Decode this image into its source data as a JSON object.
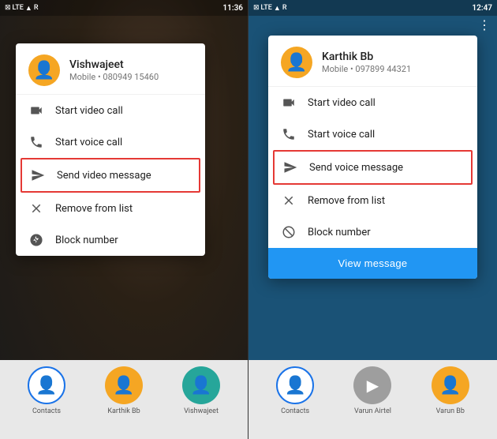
{
  "left_screen": {
    "status_bar": {
      "left_icons": "📶",
      "time": "11:36"
    },
    "contact": {
      "name": "Vishwajeet",
      "number": "Mobile • 080949 15460"
    },
    "menu_items": [
      {
        "id": "video-call",
        "label": "Start video call",
        "icon": "video"
      },
      {
        "id": "voice-call",
        "label": "Start voice call",
        "icon": "phone"
      },
      {
        "id": "video-message",
        "label": "Send video message",
        "icon": "send",
        "highlighted": true
      },
      {
        "id": "remove-list",
        "label": "Remove from list",
        "icon": "close"
      },
      {
        "id": "block",
        "label": "Block number",
        "icon": "block"
      }
    ],
    "bottom_icons": [
      {
        "label": "Contacts",
        "type": "blue-outline"
      },
      {
        "label": "Karthik Bb",
        "type": "yellow"
      },
      {
        "label": "Vishwajeet",
        "type": "teal"
      }
    ]
  },
  "right_screen": {
    "status_bar": {
      "left_icons": "📶",
      "time": "12:47"
    },
    "contact": {
      "name": "Karthik Bb",
      "number": "Mobile • 097899 44321"
    },
    "menu_items": [
      {
        "id": "video-call",
        "label": "Start video call",
        "icon": "video"
      },
      {
        "id": "voice-call",
        "label": "Start voice call",
        "icon": "phone"
      },
      {
        "id": "voice-message",
        "label": "Send voice message",
        "icon": "send",
        "highlighted": true
      },
      {
        "id": "remove-list",
        "label": "Remove from list",
        "icon": "close"
      },
      {
        "id": "block",
        "label": "Block number",
        "icon": "block"
      }
    ],
    "view_message_button": "View message",
    "bottom_icons": [
      {
        "label": "Contacts",
        "type": "blue-outline"
      },
      {
        "label": "Varun Airtel",
        "type": "gray"
      },
      {
        "label": "Varun Bb",
        "type": "yellow"
      }
    ]
  }
}
